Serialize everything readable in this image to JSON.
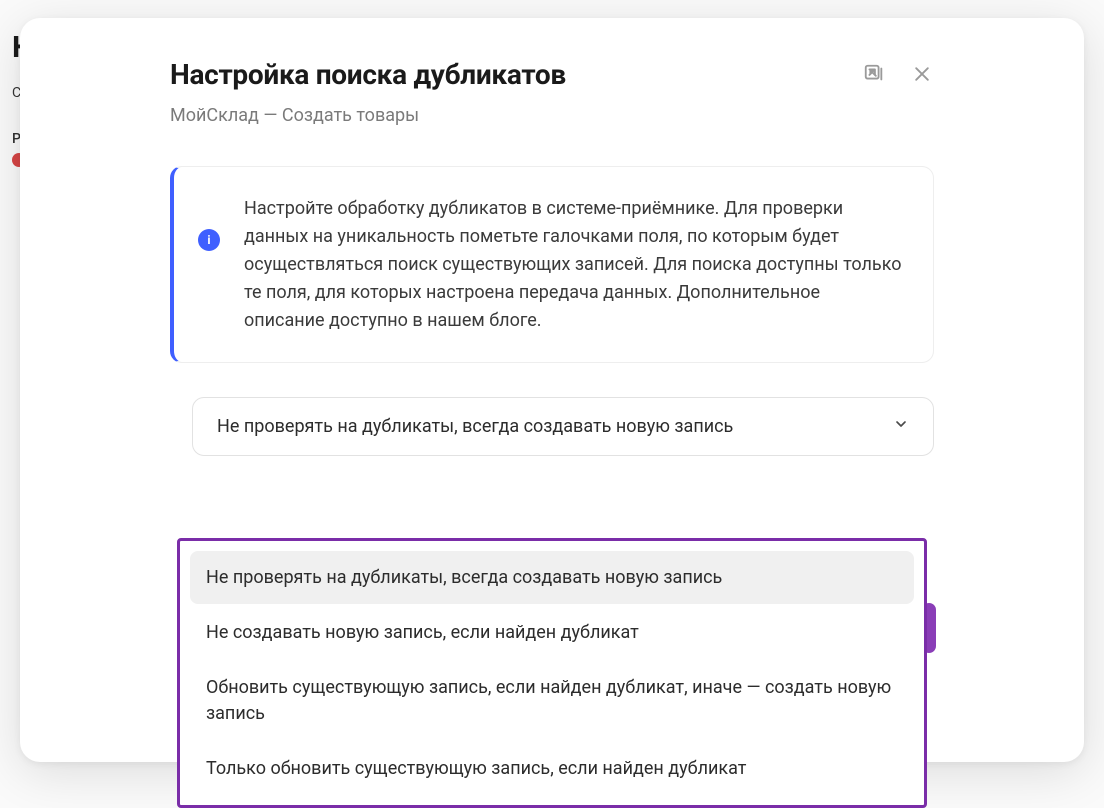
{
  "background": {
    "title": "К",
    "line1": "С",
    "line2": "Р"
  },
  "modal": {
    "title": "Настройка поиска дубликатов",
    "subtitle": "МойСклад — Создать товары",
    "info_text": "Настройте обработку дубликатов в системе-приёмнике. Для проверки данных на уникальность пометьте галочками поля, по которым будет осуществляться поиск существующих записей. Для поиска доступны только те поля, для которых настроена передача данных. Дополнительное описание доступно в нашем блоге.",
    "info_icon": "i",
    "select_value": "Не проверять на дубликаты, всегда создавать новую запись",
    "options": [
      "Не проверять на дубликаты, всегда создавать новую запись",
      "Не создавать новую запись, если найден дубликат",
      "Обновить существующую запись, если найден дубликат, иначе — создать новую запись",
      "Только обновить существующую запись, если найден дубликат"
    ]
  }
}
